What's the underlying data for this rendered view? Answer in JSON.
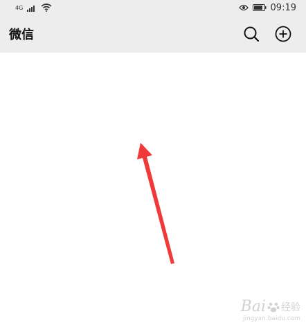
{
  "status_bar": {
    "network": "4G",
    "time": "09:19",
    "icons": [
      "signal-icon",
      "wifi-icon",
      "eye-icon",
      "battery-icon"
    ]
  },
  "app_bar": {
    "title": "微信",
    "icons": [
      "search-icon",
      "add-circle-icon"
    ]
  },
  "annotation": {
    "type": "red-arrow",
    "color": "#f03a3a"
  },
  "watermark": {
    "brand": "Bai",
    "suffix": "经验",
    "url": "jingyan.baidu.com",
    "icon": "paw-icon"
  },
  "colors": {
    "bar_bg": "#ededed",
    "content_bg": "#ffffff",
    "arrow": "#f03a3a"
  }
}
